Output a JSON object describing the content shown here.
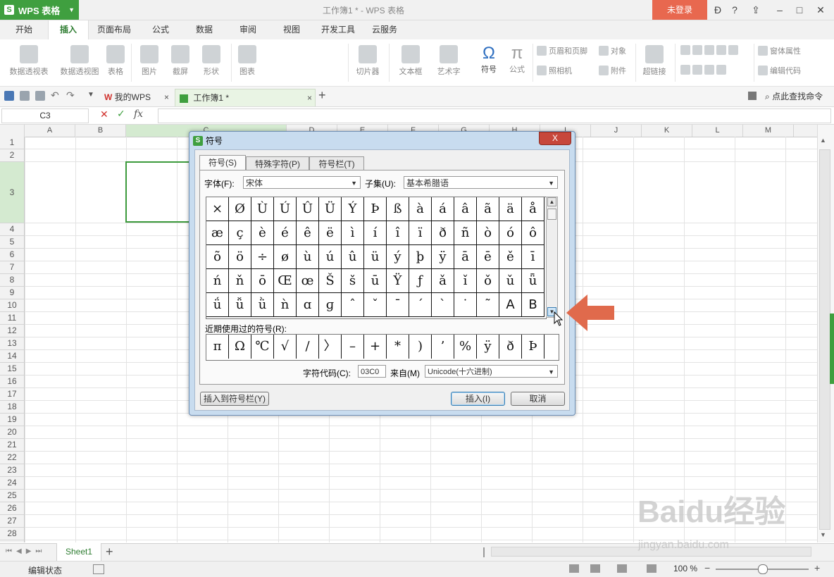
{
  "app": {
    "name": "WPS 表格",
    "window_title": "工作簿1 * - WPS 表格",
    "login": "未登录",
    "brand_color": "#3f9f3f"
  },
  "menu_tabs": [
    "开始",
    "插入",
    "页面布局",
    "公式",
    "数据",
    "审阅",
    "视图",
    "开发工具",
    "云服务"
  ],
  "ribbon": {
    "pivot_table": "数据透视表",
    "pivot_chart": "数据透视图",
    "table": "表格",
    "picture": "图片",
    "screenshot": "截屏",
    "shape": "形状",
    "chart": "图表",
    "slicer": "切片器",
    "textbox": "文本框",
    "wordart": "艺术字",
    "symbol": "符号",
    "formula": "公式",
    "header_footer": "页眉和页脚",
    "object": "对象",
    "camera": "照相机",
    "attachment": "附件",
    "hyperlink": "超链接",
    "form_props": "窗体属性",
    "edit_code": "编辑代码",
    "symbol_glyph": "Ω",
    "formula_glyph": "π"
  },
  "doc_tabs": {
    "my_wps": "我的WPS",
    "workbook": "工作簿1 *",
    "search": "点此查找命令"
  },
  "formula_bar": {
    "cell_ref": "C3",
    "fx": "fx"
  },
  "columns": [
    "A",
    "B",
    "C",
    "D",
    "E",
    "F",
    "G",
    "H",
    "I",
    "J",
    "K",
    "L",
    "M"
  ],
  "rows": [
    "1",
    "2",
    "3",
    "4",
    "5",
    "6",
    "7",
    "8",
    "9",
    "10",
    "11",
    "12",
    "13",
    "14",
    "15",
    "16",
    "17",
    "18",
    "19",
    "20",
    "21",
    "22",
    "23",
    "24",
    "25",
    "26",
    "27",
    "28"
  ],
  "sheet": {
    "name": "Sheet1",
    "add": "+"
  },
  "status": {
    "mode": "编辑状态",
    "zoom": "100 %"
  },
  "dialog": {
    "title": "符号",
    "close": "X",
    "tabs": [
      "符号(S)",
      "特殊字符(P)",
      "符号栏(T)"
    ],
    "font_label": "字体(F):",
    "font_value": "宋体",
    "subset_label": "子集(U):",
    "subset_value": "基本希腊语",
    "symbols": [
      [
        "×",
        "Ø",
        "Ù",
        "Ú",
        "Û",
        "Ü",
        "Ý",
        "Þ",
        "ß",
        "à",
        "á",
        "â",
        "ã",
        "ä",
        "å"
      ],
      [
        "æ",
        "ç",
        "è",
        "é",
        "ê",
        "ë",
        "ì",
        "í",
        "î",
        "ï",
        "ð",
        "ñ",
        "ò",
        "ó",
        "ô"
      ],
      [
        "õ",
        "ö",
        "÷",
        "ø",
        "ù",
        "ú",
        "û",
        "ü",
        "ý",
        "þ",
        "ÿ",
        "ā",
        "ē",
        "ě",
        "ī"
      ],
      [
        "ń",
        "ň",
        "ō",
        "Œ",
        "œ",
        "Š",
        "š",
        "ū",
        "Ÿ",
        "ƒ",
        "ǎ",
        "ǐ",
        "ǒ",
        "ǔ",
        "ǖ"
      ],
      [
        "ǘ",
        "ǚ",
        "ǜ",
        "ǹ",
        "ɑ",
        "ɡ",
        "ˆ",
        "ˇ",
        "ˉ",
        "ˊ",
        "ˋ",
        "˙",
        "˜",
        "A",
        "B"
      ]
    ],
    "recent_label": "近期使用过的符号(R):",
    "recent": [
      "π",
      "Ω",
      "℃",
      "√",
      "/",
      "〉",
      "–",
      "+",
      "*",
      ")",
      "’",
      "%",
      "ÿ",
      "ð",
      "Þ"
    ],
    "code_label": "字符代码(C):",
    "code_value": "03C0",
    "from_label": "来自(M)",
    "from_value": "Unicode(十六进制)",
    "insert_to_bar": "插入到符号栏(Y)",
    "insert": "插入(I)",
    "cancel": "取消"
  },
  "watermark": {
    "logo": "Baidu经验",
    "url": "jingyan.baidu.com"
  },
  "colors": {
    "accent": "#3f9f3f",
    "login_bg": "#e8684f",
    "arrow": "#e06a4c"
  }
}
